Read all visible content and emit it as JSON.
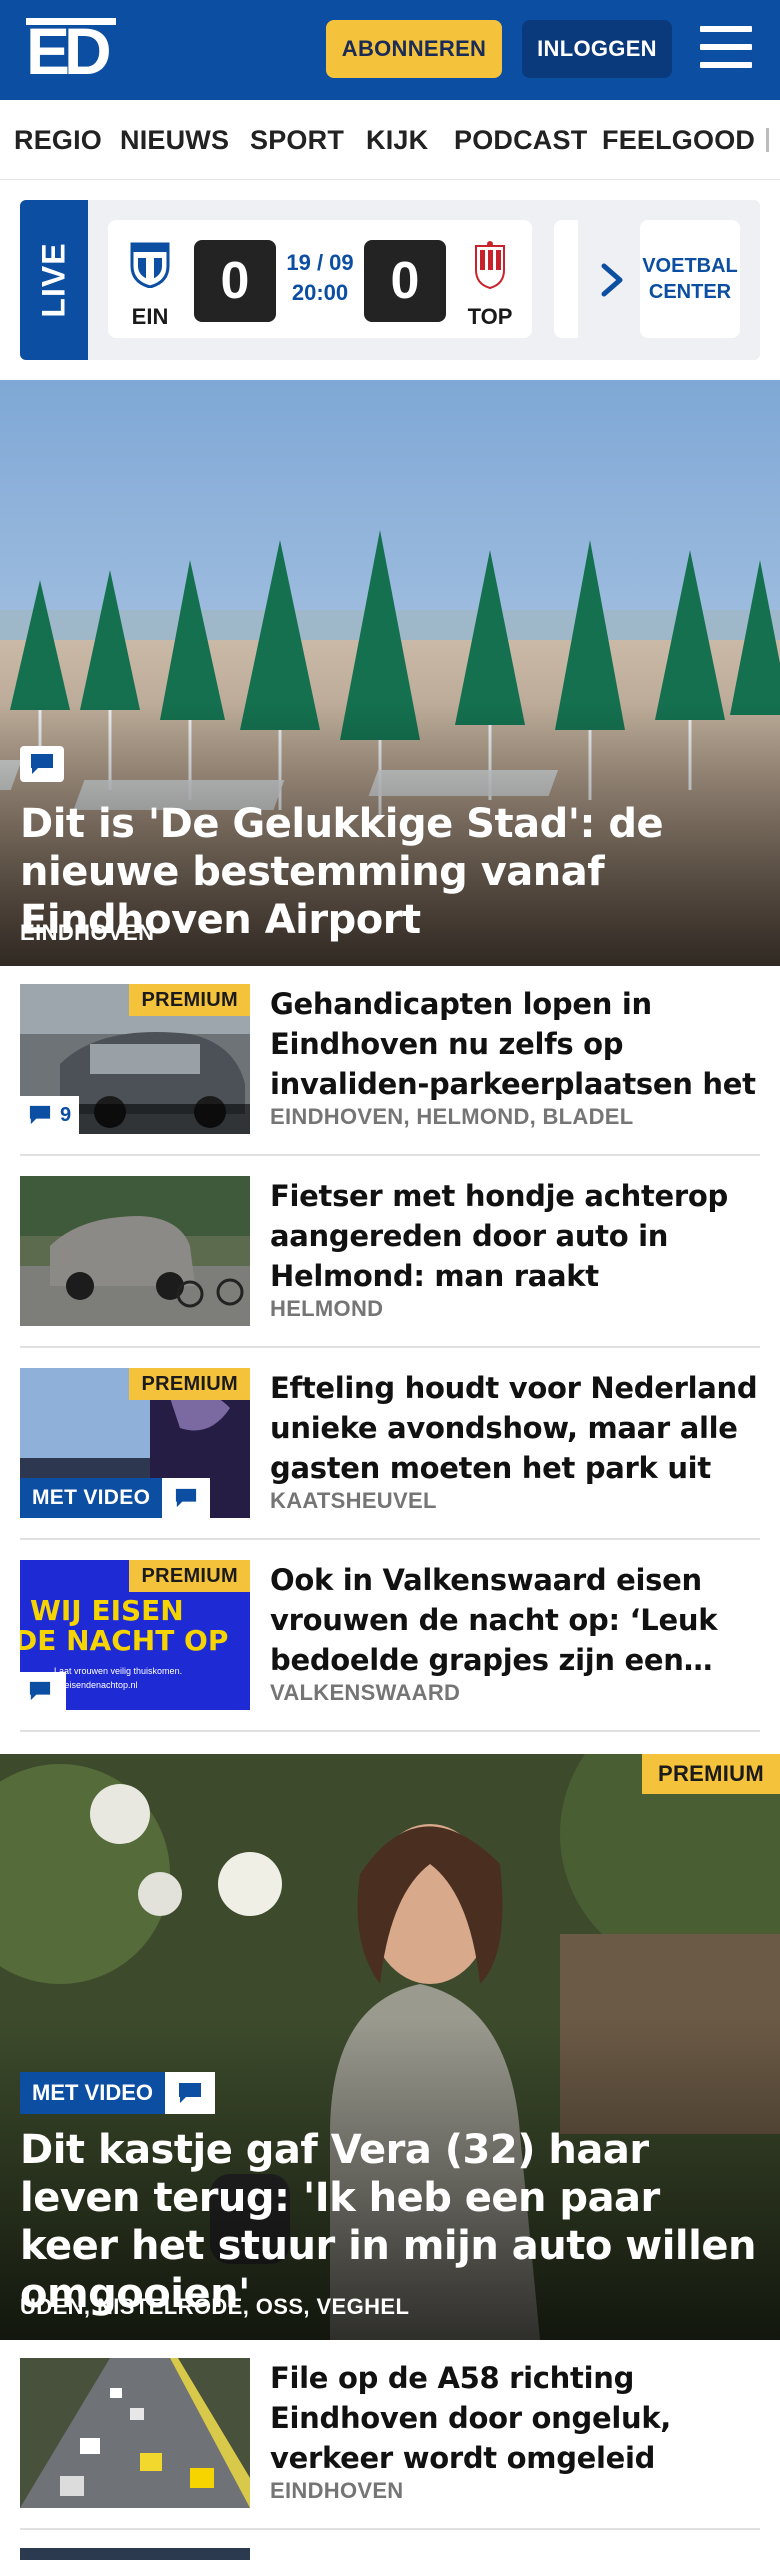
{
  "header": {
    "logo_text": "ED",
    "subscribe_label": "ABONNEREN",
    "login_label": "INLOGGEN",
    "colors": {
      "brand_blue": "#0b4ea2",
      "accent_yellow": "#f5c33b"
    }
  },
  "nav": {
    "items": [
      "REGIO",
      "NIEUWS",
      "SPORT",
      "KIJK",
      "PODCAST",
      "FEELGOOD"
    ]
  },
  "live": {
    "label": "LIVE",
    "match": {
      "home_team": "EIN",
      "home_score": "0",
      "date": "19 / 09",
      "time": "20:00",
      "away_score": "0",
      "away_team": "TOP"
    },
    "voetbal_center_line1": "VOETBAL",
    "voetbal_center_line2": "CENTER"
  },
  "hero": {
    "title": "Dit is 'De Gelukkige Stad': de nieuwe bestemming vanaf Eindhoven Airport",
    "location": "EINDHOVEN",
    "icon": "comment-icon"
  },
  "articles": [
    {
      "title": "Gehandicapten lopen in Eindhoven nu zelfs op invaliden-parkeerplaatsen het risico op…",
      "location": "EINDHOVEN, HELMOND, BLADEL",
      "premium": "PREMIUM",
      "comments": "9"
    },
    {
      "title": "Fietser met hondje achterop aangereden door auto in Helmond: man raakt gewond,…",
      "location": "HELMOND"
    },
    {
      "title": "Efteling houdt voor Nederland unieke avondshow, maar alle gasten moeten het park uit",
      "location": "KAATSHEUVEL",
      "premium": "PREMIUM",
      "video": "MET VIDEO"
    },
    {
      "title": "Ook in Valkenswaard eisen vrouwen de nacht op: ‘Leuk bedoelde grapjes zijn een…",
      "location": "VALKENSWAARD",
      "premium": "PREMIUM",
      "thumb_text1": "WIJ EISEN",
      "thumb_text2": "DE NACHT OP",
      "thumb_small1": "Laat vrouwen veilig thuiskomen.",
      "thumb_small2": "wijeisendenachtop.nl"
    }
  ],
  "feature": {
    "premium": "PREMIUM",
    "video": "MET VIDEO",
    "title": "Dit kastje gaf Vera (32) haar leven terug: 'Ik heb een paar keer het stuur in mijn auto willen omgooien'",
    "location": "UDEN, NISTELRODE, OSS, VEGHEL"
  },
  "articles2": [
    {
      "title": "File op de A58 richting Eindhoven door ongeluk, verkeer wordt omgeleid",
      "location": "EINDHOVEN"
    }
  ]
}
